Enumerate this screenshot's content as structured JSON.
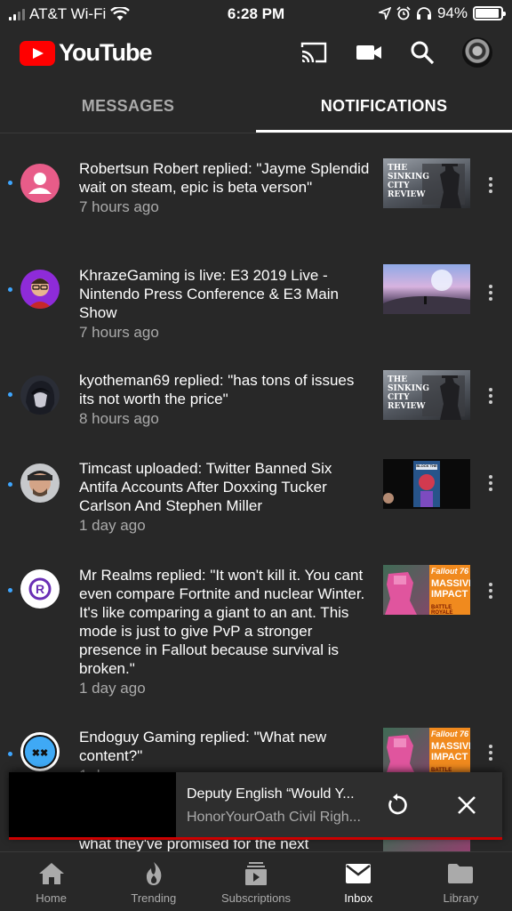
{
  "status_bar": {
    "carrier": "AT&T Wi-Fi",
    "time": "6:28 PM",
    "battery": "94%",
    "battery_level": 0.94
  },
  "header": {
    "app_name": "YouTube",
    "icons": [
      "cast-icon",
      "camera-icon",
      "search-icon",
      "account-avatar"
    ]
  },
  "tabs": [
    {
      "label": "MESSAGES",
      "active": false
    },
    {
      "label": "NOTIFICATIONS",
      "active": true
    }
  ],
  "notifications": [
    {
      "text": "Robertsun Robert replied: \"Jayme Splendid wait on steam, epic is beta verson\"",
      "time": "7 hours ago",
      "avatar": "default-person-avatar",
      "thumbnail": "sinking-city-review-thumbnail"
    },
    {
      "text": "KhrazeGaming is live: E3 2019 Live - Nintendo Press Conference & E3 Main Show",
      "time": "7 hours ago",
      "avatar": "khrazegaming-avatar",
      "thumbnail": "e3-live-landscape-thumbnail"
    },
    {
      "text": "kyotheman69 replied: \"has tons of issues its not worth the price\"",
      "time": "8 hours ago",
      "avatar": "kyotheman69-avatar",
      "thumbnail": "sinking-city-review-thumbnail"
    },
    {
      "text": "Timcast uploaded: Twitter Banned Six Antifa Accounts After Doxxing Tucker Carlson And Stephen Miller",
      "time": "1 day ago",
      "avatar": "timcast-avatar",
      "thumbnail": "timcast-video-thumbnail"
    },
    {
      "text": "Mr Realms replied: \"It won't kill it. You cant even compare Fortnite and nuclear Winter. It's like comparing a giant to an ant. This mode is just to give PvP a stronger presence in Fallout because survival is broken.\"",
      "time": "1 day ago",
      "avatar": "mr-realms-avatar",
      "thumbnail": "fallout-massive-impact-thumbnail"
    },
    {
      "text": "Endoguy Gaming replied: \"What new content?\"",
      "time": "1 day ago",
      "avatar": "endoguy-avatar",
      "thumbnail": "fallout-massive-impact-thumbnail"
    },
    {
      "text": "what they've promised for the next",
      "time": "",
      "avatar": "",
      "thumbnail": "fallout-massive-impact-thumbnail"
    }
  ],
  "thumbnail_text": {
    "sinking_city": "THE SINKING CITY REVIEW",
    "fallout_brand": "Fallout 76",
    "fallout_title": "MASSIVE IMPACT",
    "fallout_sub": "BATTLE ROYALE",
    "timcast_tag": "BLOCK THE"
  },
  "mini_player": {
    "title": "Deputy English “Would Y...",
    "channel": "HonorYourOath Civil Righ...",
    "progress": 1.0
  },
  "bottom_nav": [
    {
      "label": "Home",
      "icon": "home-icon",
      "active": false
    },
    {
      "label": "Trending",
      "icon": "flame-icon",
      "active": false
    },
    {
      "label": "Subscriptions",
      "icon": "subscriptions-icon",
      "active": false
    },
    {
      "label": "Inbox",
      "icon": "mail-icon",
      "active": true
    },
    {
      "label": "Library",
      "icon": "folder-icon",
      "active": false
    }
  ],
  "colors": {
    "background": "#282828",
    "brand_red": "#ff0000",
    "unread_dot": "#3ea6ff",
    "secondary_text": "#aaaaaa"
  }
}
